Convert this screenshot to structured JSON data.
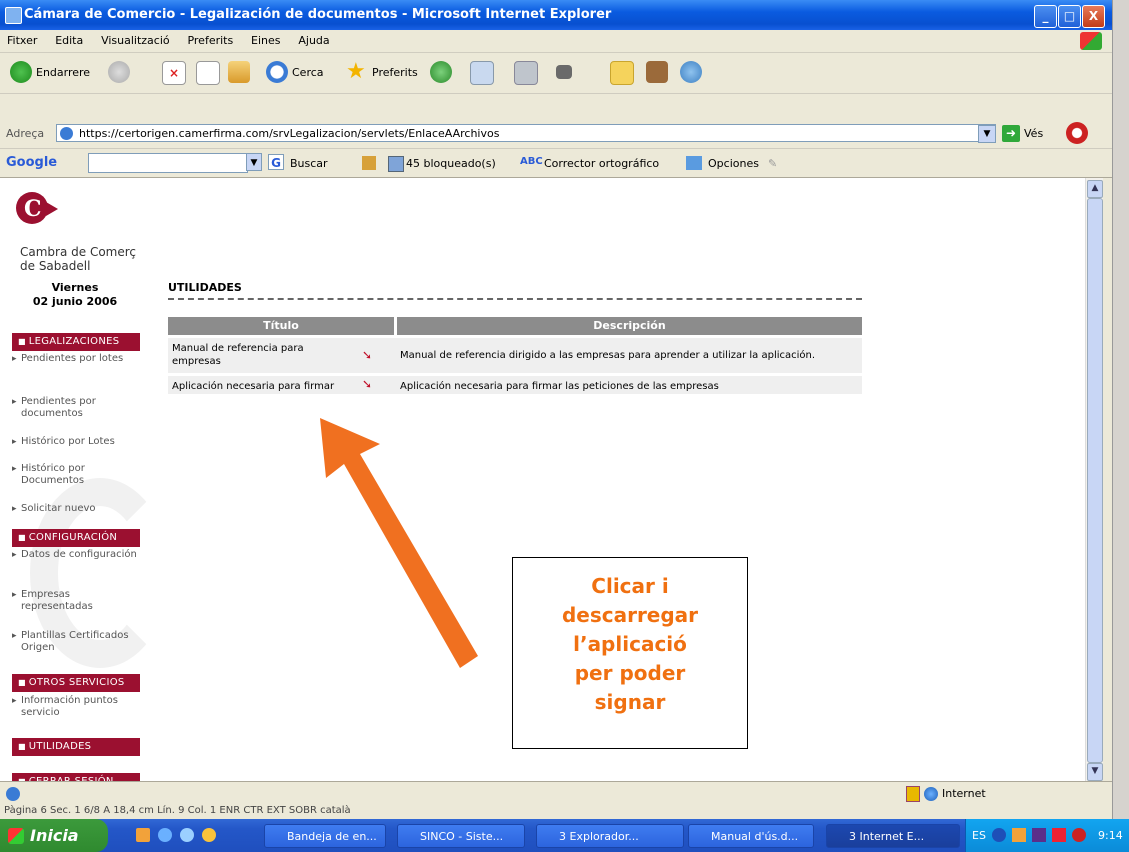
{
  "window": {
    "title": "Cámara de Comercio - Legalización de documentos - Microsoft Internet Explorer",
    "btn_min": "_",
    "btn_max": "□",
    "btn_close": "X"
  },
  "menu": [
    "Fitxer",
    "Edita",
    "Visualització",
    "Preferits",
    "Eines",
    "Ajuda"
  ],
  "toolbar": {
    "back": "Endarrere",
    "search": "Cerca",
    "favorites": "Preferits"
  },
  "address": {
    "label": "Adreça",
    "url": "https://certorigen.camerfirma.com/srvLegalizacion/servlets/EnlaceAArchivos",
    "go": "Vés"
  },
  "googlebar": {
    "logo": "Google",
    "buscar": "Buscar",
    "blocked": "45 bloqueado(s)",
    "spell": "Corrector ortográfico",
    "options": "Opciones"
  },
  "sidebar": {
    "org_line1": "Cambra de Comerç",
    "org_line2": "de Sabadell",
    "day": "Viernes",
    "date": "02 junio 2006",
    "sections": [
      {
        "title": "LEGALIZACIONES",
        "items": [
          "Pendientes por lotes",
          "Pendientes por documentos",
          "Histórico por Lotes",
          "Histórico por Documentos",
          "Solicitar nuevo"
        ]
      },
      {
        "title": "CONFIGURACIÓN",
        "items": [
          "Datos de configuración",
          "Empresas representadas",
          "Plantillas Certificados Origen"
        ]
      },
      {
        "title": "OTROS SERVICIOS",
        "items": [
          "Información puntos servicio"
        ]
      },
      {
        "title": "UTILIDADES",
        "items": []
      },
      {
        "title": "CERRAR SESIÓN",
        "items": []
      }
    ]
  },
  "main": {
    "title": "UTILIDADES",
    "columns": [
      "Título",
      "Descripción"
    ],
    "rows": [
      {
        "title": "Manual de referencia para empresas",
        "description": "Manual de referencia dirigido a las empresas para aprender a utilizar la aplicación."
      },
      {
        "title": "Aplicación necesaria para firmar",
        "description": "Aplicación necesaria para firmar las peticiones de las empresas"
      }
    ]
  },
  "annotation": {
    "lines": [
      "Clicar i",
      "descarregar",
      "l’aplicació",
      "per poder",
      "signar"
    ],
    "color": "#f07010"
  },
  "statusbar": {
    "zone": "Internet",
    "word": "Pàgina 6    Sec. 1    6/8    A 18,4 cm  Lín. 9    Col. 1    ENR  CTR  EXT  SOBR    català"
  },
  "taskbar": {
    "start": "Inicia",
    "tasks": [
      "Bandeja de en...",
      "SINCO - Siste...",
      "3 Explorador...",
      "Manual d'ús.d...",
      "3 Internet E..."
    ],
    "lang": "ES",
    "time": "9:14"
  }
}
